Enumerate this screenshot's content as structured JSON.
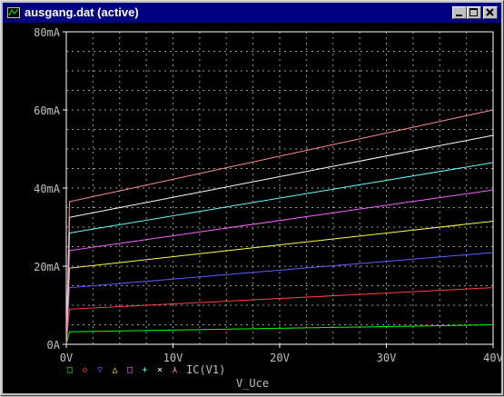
{
  "window": {
    "title": "ausgang.dat (active)"
  },
  "controls": {
    "minimize": "minimize-button",
    "maximize": "maximize-button",
    "close": "close-button"
  },
  "colors": {
    "background": "#000000",
    "grid": "#9a9a9a",
    "axis_text": "#c0c0c0",
    "titlebar": "#000080"
  },
  "legend": {
    "label": "IC(V1)",
    "markers": [
      {
        "symbol": "□",
        "color": "#00ff00"
      },
      {
        "symbol": "◇",
        "color": "#ff4040"
      },
      {
        "symbol": "▽",
        "color": "#6060ff"
      },
      {
        "symbol": "△",
        "color": "#ffff40"
      },
      {
        "symbol": "□",
        "color": "#ff60ff"
      },
      {
        "symbol": "+",
        "color": "#60ffff"
      },
      {
        "symbol": "×",
        "color": "#ffffff"
      },
      {
        "symbol": "⋏",
        "color": "#ff9090"
      }
    ]
  },
  "chart_data": {
    "type": "line",
    "xlabel": "V_Uce",
    "ylabel": "",
    "xlim": [
      0,
      40
    ],
    "ylim": [
      0,
      80
    ],
    "grid": true,
    "x_ticks": [
      0,
      10,
      20,
      30,
      40
    ],
    "x_tick_labels": [
      "0V",
      "10V",
      "20V",
      "30V",
      "40V"
    ],
    "y_ticks": [
      0,
      20,
      40,
      60,
      80
    ],
    "y_tick_labels": [
      "0A",
      "20mA",
      "40mA",
      "60mA",
      "80mA"
    ],
    "series": [
      {
        "color": "#00ff00",
        "x": [
          0,
          0.3,
          40
        ],
        "y": [
          0,
          3.2,
          5.0
        ]
      },
      {
        "color": "#ff4040",
        "x": [
          0,
          0.3,
          40
        ],
        "y": [
          0,
          9.0,
          14.5
        ]
      },
      {
        "color": "#6060ff",
        "x": [
          0,
          0.3,
          40
        ],
        "y": [
          0,
          14.5,
          23.5
        ]
      },
      {
        "color": "#ffff40",
        "x": [
          0,
          0.3,
          40
        ],
        "y": [
          0,
          19.5,
          31.5
        ]
      },
      {
        "color": "#ff60ff",
        "x": [
          0,
          0.3,
          40
        ],
        "y": [
          0,
          24.0,
          39.5
        ]
      },
      {
        "color": "#60ffff",
        "x": [
          0,
          0.3,
          40
        ],
        "y": [
          0,
          28.5,
          46.5
        ]
      },
      {
        "color": "#ffffff",
        "x": [
          0,
          0.3,
          40
        ],
        "y": [
          0,
          32.5,
          53.5
        ]
      },
      {
        "color": "#ff9090",
        "x": [
          0,
          0.3,
          40
        ],
        "y": [
          0,
          36.5,
          60.0
        ]
      }
    ]
  }
}
